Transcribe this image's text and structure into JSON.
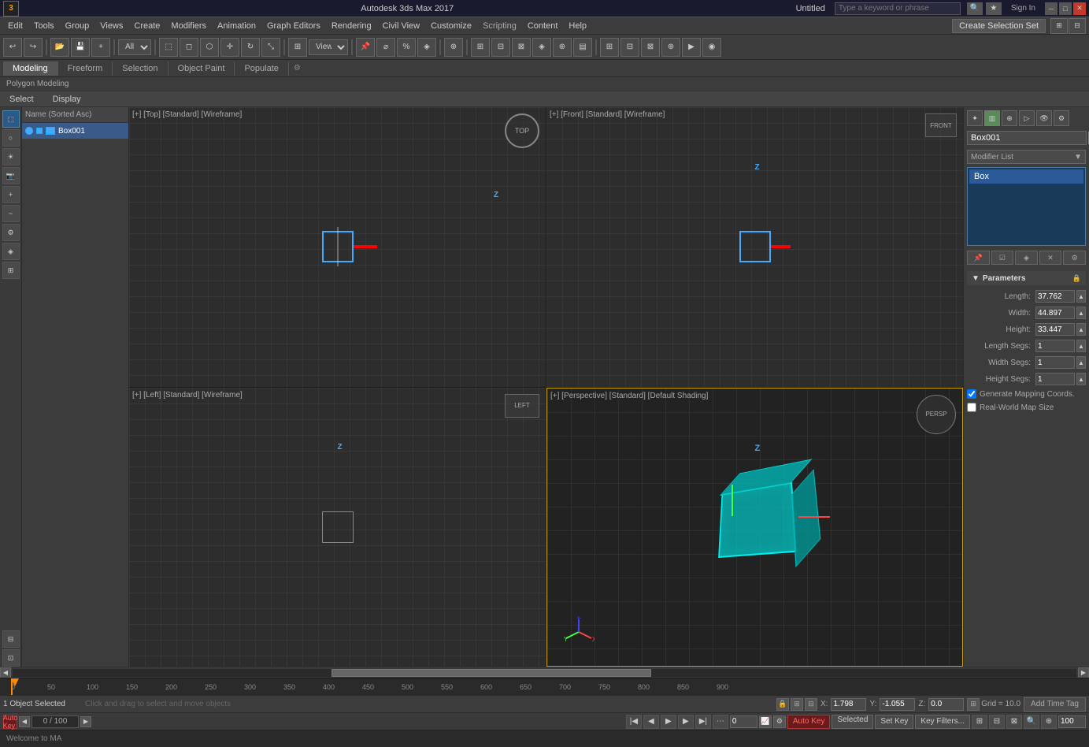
{
  "titlebar": {
    "logo": "3",
    "app_name": "Autodesk 3ds Max 2017",
    "file_name": "Untitled",
    "search_placeholder": "Type a keyword or phrase",
    "sign_in": "Sign In",
    "min_label": "─",
    "max_label": "□",
    "close_label": "✕"
  },
  "menubar": {
    "items": [
      "Edit",
      "Tools",
      "Group",
      "Views",
      "Create",
      "Modifiers",
      "Animation",
      "Graph Editors",
      "Rendering",
      "Civil View",
      "Customize",
      "Scripting",
      "Content",
      "Help"
    ],
    "create_selection": "Create Selection Set"
  },
  "tabs": {
    "items": [
      "Modeling",
      "Freeform",
      "Selection",
      "Object Paint",
      "Populate"
    ],
    "active": "Modeling",
    "breadcrumb": "Polygon Modeling"
  },
  "subtabs": {
    "items": [
      "Select",
      "Display"
    ]
  },
  "left_panel": {
    "list_header": "Name (Sorted Asc)",
    "object": "Box001"
  },
  "viewports": {
    "top": "[+] [Top] [Standard] [Wireframe]",
    "front": "[+] [Front] [Standard] [Wireframe]",
    "left": "[+] [Left] [Standard] [Wireframe]",
    "perspective": "[+] [Perspective] [Standard] [Default Shading]"
  },
  "right_panel": {
    "object_name": "Box001",
    "modifier_list_label": "Modifier List",
    "modifier_item": "Box",
    "parameters_label": "Parameters",
    "length_label": "Length:",
    "length_value": "37.762",
    "width_label": "Width:",
    "width_value": "44.897",
    "height_label": "Height:",
    "height_value": "33.447",
    "length_segs_label": "Length Segs:",
    "length_segs_value": "1",
    "width_segs_label": "Width Segs:",
    "width_segs_value": "1",
    "height_segs_label": "Height Segs:",
    "height_segs_value": "1",
    "gen_mapping_label": "Generate Mapping Coords.",
    "real_world_label": "Real-World Map Size"
  },
  "statusbar": {
    "objects_selected": "1 Object Selected",
    "hint": "Click and drag to select and move objects",
    "x_label": "X:",
    "x_value": "1.798",
    "y_label": "Y:",
    "y_value": "-1.055",
    "z_label": "Z:",
    "z_value": "0.0",
    "grid_label": "Grid = 10.0"
  },
  "animbar": {
    "auto_key": "Auto Key",
    "selected_label": "Selected",
    "set_key": "Set Key",
    "key_filters": "Key Filters...",
    "timeline_start": "0",
    "timeline_end": "100",
    "add_time_tag": "Add Time Tag"
  },
  "welcomebar": {
    "text": "Welcome to MA"
  },
  "timeline_markers": [
    "0",
    "50",
    "100",
    "150",
    "200",
    "250",
    "300",
    "350",
    "400",
    "450",
    "500",
    "550",
    "600",
    "650",
    "700",
    "750",
    "800",
    "850",
    "900"
  ],
  "toolbar_items": [
    "undo",
    "redo",
    "open",
    "save",
    "select",
    "move",
    "rotate",
    "scale",
    "snap",
    "view-port-config"
  ],
  "side_icons": [
    "geometry",
    "shapes",
    "lights",
    "cameras",
    "helpers",
    "spacewarps",
    "systems",
    "modifiers2",
    "scene"
  ],
  "frame_counter": "0 / 100"
}
